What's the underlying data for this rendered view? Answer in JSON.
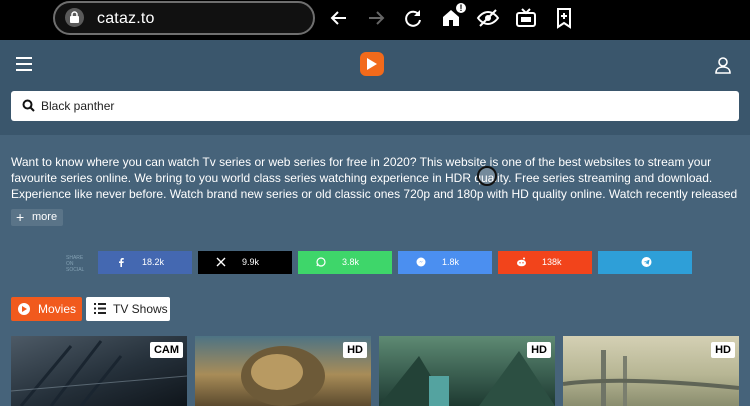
{
  "browser": {
    "url": "cataz.to",
    "home_badge": "!"
  },
  "header": {
    "search_value": "Black panther"
  },
  "description": {
    "text": "Want to know where you can watch Tv series or web series for free in 2020? This website is one of the best websites to stream your favourite series online. We bring to you world class series watching experience in HDR quality. Free series streaming and download. Experience like never before. Watch brand new series or old classic ones 720p and 180p with HD quality online. Watch recently released web series and TV series only here. Don't…",
    "more_label": "more"
  },
  "share": {
    "label": "SHARE ON SOCIAL",
    "items": [
      {
        "network": "facebook",
        "icon": "facebook-icon",
        "count": "18.2k",
        "color": "#4468b1"
      },
      {
        "network": "x",
        "icon": "x-icon",
        "count": "9.9k",
        "color": "#000000"
      },
      {
        "network": "whatsapp",
        "icon": "whatsapp-icon",
        "count": "3.8k",
        "color": "#3ed66a"
      },
      {
        "network": "messenger",
        "icon": "messenger-icon",
        "count": "1.8k",
        "color": "#4b8ff0"
      },
      {
        "network": "reddit",
        "icon": "reddit-icon",
        "count": "138k",
        "color": "#f2441b"
      },
      {
        "network": "telegram",
        "icon": "telegram-icon",
        "count": "",
        "color": "#2e9fd8"
      }
    ]
  },
  "tabs": [
    {
      "label": "Movies",
      "active": true
    },
    {
      "label": "TV Shows",
      "active": false
    }
  ],
  "cards": [
    {
      "quality": "CAM"
    },
    {
      "quality": "HD"
    },
    {
      "quality": "HD"
    },
    {
      "quality": "HD"
    }
  ],
  "colors": {
    "accent": "#f15a1d",
    "page_bg": "#46637a",
    "header_bg": "#3a566c"
  }
}
